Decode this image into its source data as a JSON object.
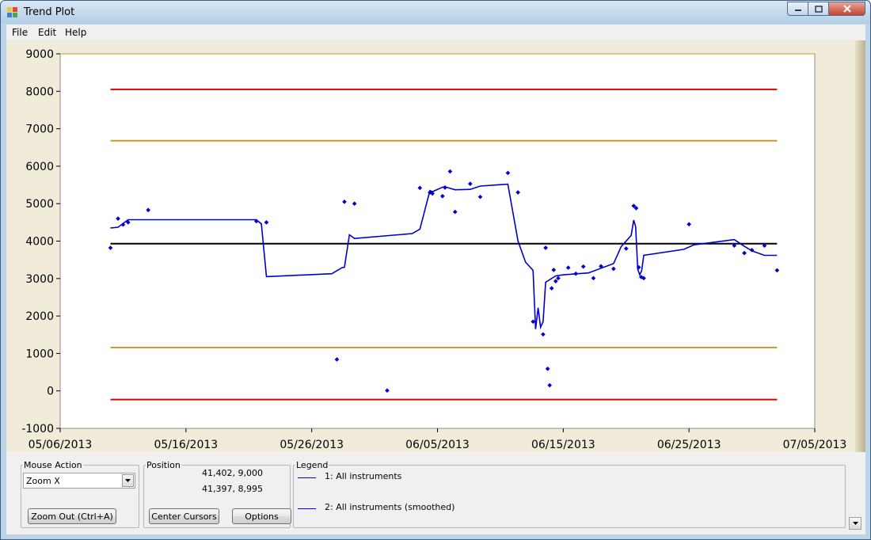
{
  "window": {
    "title": "Trend Plot"
  },
  "menu": {
    "file": "File",
    "edit": "Edit",
    "help": "Help"
  },
  "colors": {
    "series": "#0000cc",
    "limit_hi": "#dd0000",
    "limit_warn": "#c89a28",
    "mean": "#000000"
  },
  "chart_data": {
    "type": "line",
    "title": "",
    "xlabel": "",
    "ylabel": "",
    "ylim": [
      -1000,
      9000
    ],
    "xlim": [
      "2013-05-06",
      "2013-07-05"
    ],
    "grid": false,
    "xticks": [
      "05/06/2013",
      "05/16/2013",
      "05/26/2013",
      "06/05/2013",
      "06/15/2013",
      "06/25/2013",
      "07/05/2013"
    ],
    "yticks": [
      "9000",
      "8000",
      "7000",
      "6000",
      "5000",
      "4000",
      "3000",
      "2000",
      "1000",
      "0",
      "-1000"
    ],
    "reference_lines": [
      {
        "y": 8050,
        "color": "#dd0000",
        "from": "2013-05-10",
        "to": "2013-07-02"
      },
      {
        "y": 6680,
        "color": "#c89a28",
        "from": "2013-05-10",
        "to": "2013-07-02"
      },
      {
        "y": 3930,
        "color": "#000000",
        "from": "2013-05-10",
        "to": "2013-07-02"
      },
      {
        "y": 1160,
        "color": "#c89a28",
        "from": "2013-05-10",
        "to": "2013-07-02"
      },
      {
        "y": -230,
        "color": "#dd0000",
        "from": "2013-05-10",
        "to": "2013-07-02"
      }
    ],
    "series": [
      {
        "name": "1: All instruments",
        "points": [
          [
            "2013-05-10",
            3820
          ],
          [
            "2013-05-11",
            4600
          ],
          [
            "2013-05-11",
            4440
          ],
          [
            "2013-05-11",
            4500
          ],
          [
            "2013-05-13",
            4830
          ],
          [
            "2013-05-22",
            4530
          ],
          [
            "2013-05-22",
            4500
          ],
          [
            "2013-05-28",
            840
          ],
          [
            "2013-05-29",
            5050
          ],
          [
            "2013-05-29",
            5000
          ],
          [
            "2013-06-01",
            10
          ],
          [
            "2013-06-04",
            5420
          ],
          [
            "2013-06-04",
            5300
          ],
          [
            "2013-06-05",
            5270
          ],
          [
            "2013-06-05",
            5200
          ],
          [
            "2013-06-06",
            5430
          ],
          [
            "2013-06-06",
            5860
          ],
          [
            "2013-06-06",
            4780
          ],
          [
            "2013-06-08",
            5530
          ],
          [
            "2013-06-08",
            5180
          ],
          [
            "2013-06-11",
            5820
          ],
          [
            "2013-06-11",
            5300
          ],
          [
            "2013-06-13",
            1850
          ],
          [
            "2013-06-13",
            1510
          ],
          [
            "2013-06-14",
            3820
          ],
          [
            "2013-06-14",
            590
          ],
          [
            "2013-06-14",
            150
          ],
          [
            "2013-06-14",
            2740
          ],
          [
            "2013-06-14",
            3230
          ],
          [
            "2013-06-14",
            2930
          ],
          [
            "2013-06-15",
            3010
          ],
          [
            "2013-06-15",
            3290
          ],
          [
            "2013-06-16",
            3130
          ],
          [
            "2013-06-17",
            3320
          ],
          [
            "2013-06-17",
            3010
          ],
          [
            "2013-06-18",
            3330
          ],
          [
            "2013-06-19",
            3260
          ],
          [
            "2013-06-20",
            3800
          ],
          [
            "2013-06-21",
            4940
          ],
          [
            "2013-06-21",
            4880
          ],
          [
            "2013-06-21",
            3300
          ],
          [
            "2013-06-21",
            3040
          ],
          [
            "2013-06-21",
            3010
          ],
          [
            "2013-06-25",
            4450
          ],
          [
            "2013-06-29",
            3880
          ],
          [
            "2013-06-29",
            3680
          ],
          [
            "2013-06-30",
            3760
          ],
          [
            "2013-07-01",
            3880
          ],
          [
            "2013-07-02",
            3220
          ]
        ]
      },
      {
        "name": "2: All instruments (smoothed)",
        "points": [
          [
            "2013-05-10",
            4350
          ],
          [
            "2013-05-11",
            4370
          ],
          [
            "2013-05-11",
            4570
          ],
          [
            "2013-05-22",
            4570
          ],
          [
            "2013-05-22",
            4460
          ],
          [
            "2013-05-22",
            3050
          ],
          [
            "2013-05-28",
            3130
          ],
          [
            "2013-05-28",
            3290
          ],
          [
            "2013-05-29",
            3300
          ],
          [
            "2013-05-29",
            4170
          ],
          [
            "2013-05-29",
            4070
          ],
          [
            "2013-06-03",
            4200
          ],
          [
            "2013-06-04",
            4320
          ],
          [
            "2013-06-04",
            5350
          ],
          [
            "2013-06-05",
            5320
          ],
          [
            "2013-06-05",
            5440
          ],
          [
            "2013-06-06",
            5450
          ],
          [
            "2013-06-06",
            5370
          ],
          [
            "2013-06-08",
            5380
          ],
          [
            "2013-06-08",
            5470
          ],
          [
            "2013-06-11",
            5520
          ],
          [
            "2013-06-11",
            4000
          ],
          [
            "2013-06-12",
            3440
          ],
          [
            "2013-06-13",
            3220
          ],
          [
            "2013-06-13",
            1650
          ],
          [
            "2013-06-13",
            2220
          ],
          [
            "2013-06-13",
            1700
          ],
          [
            "2013-06-13",
            1850
          ],
          [
            "2013-06-14",
            2900
          ],
          [
            "2013-06-14",
            3070
          ],
          [
            "2013-06-15",
            3100
          ],
          [
            "2013-06-17",
            3150
          ],
          [
            "2013-06-19",
            3400
          ],
          [
            "2013-06-20",
            3850
          ],
          [
            "2013-06-20",
            4150
          ],
          [
            "2013-06-21",
            4560
          ],
          [
            "2013-06-21",
            4380
          ],
          [
            "2013-06-21",
            3250
          ],
          [
            "2013-06-21",
            3100
          ],
          [
            "2013-06-21",
            3210
          ],
          [
            "2013-06-21",
            3620
          ],
          [
            "2013-06-25",
            3780
          ],
          [
            "2013-06-25",
            3900
          ],
          [
            "2013-06-29",
            4040
          ],
          [
            "2013-06-29",
            3860
          ],
          [
            "2013-06-30",
            3740
          ],
          [
            "2013-07-01",
            3620
          ],
          [
            "2013-07-02",
            3620
          ]
        ]
      }
    ]
  },
  "controls": {
    "mouse_action_label": "Mouse Action",
    "mouse_action_value": "Zoom X",
    "zoom_out_label": "Zoom Out (Ctrl+A)",
    "position_label": "Position",
    "position_1": "41,402, 9,000",
    "position_2": "41,397, 8,995",
    "center_cursors_label": "Center Cursors",
    "options_label": "Options",
    "legend_label": "Legend",
    "legend_1": "1: All instruments",
    "legend_2": "2: All instruments (smoothed)"
  }
}
